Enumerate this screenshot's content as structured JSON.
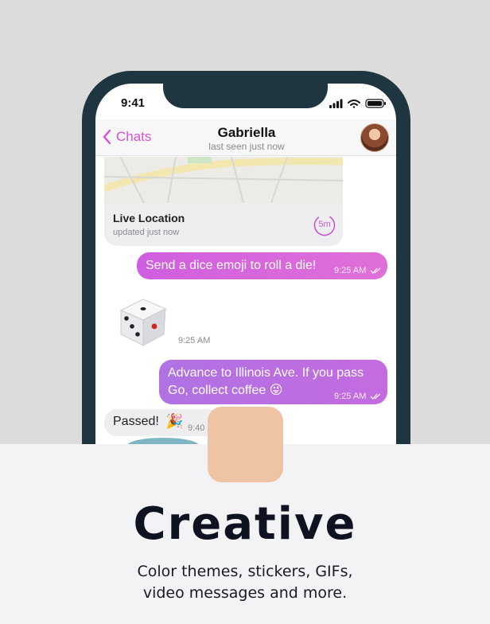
{
  "status_bar": {
    "time": "9:41"
  },
  "header": {
    "back_label": "Chats",
    "contact_name": "Gabriella",
    "contact_status": "last seen just now"
  },
  "messages": {
    "location": {
      "title": "Live Location",
      "subtitle": "updated just now",
      "timer": "5m"
    },
    "out1": {
      "text": "Send a dice emoji to roll a die!",
      "time": "9:25 AM"
    },
    "dice": {
      "time": "9:25 AM"
    },
    "out2": {
      "text": "Advance to Illinois Ave. If you pass Go, collect coffee 😜",
      "time": "9:25 AM"
    },
    "in1": {
      "text": "Passed!",
      "emoji": "🎉",
      "time": "9:40"
    }
  },
  "promo": {
    "headline": "Creative",
    "subline_1": "Color themes, stickers, GIFs,",
    "subline_2": "video messages and more."
  },
  "colors": {
    "accent": "#d94fd5",
    "bubble_out": "#d46add",
    "bubble_in": "#eeeef1",
    "phone_frame": "#1f3540",
    "app_icon": "#efc4a5"
  }
}
